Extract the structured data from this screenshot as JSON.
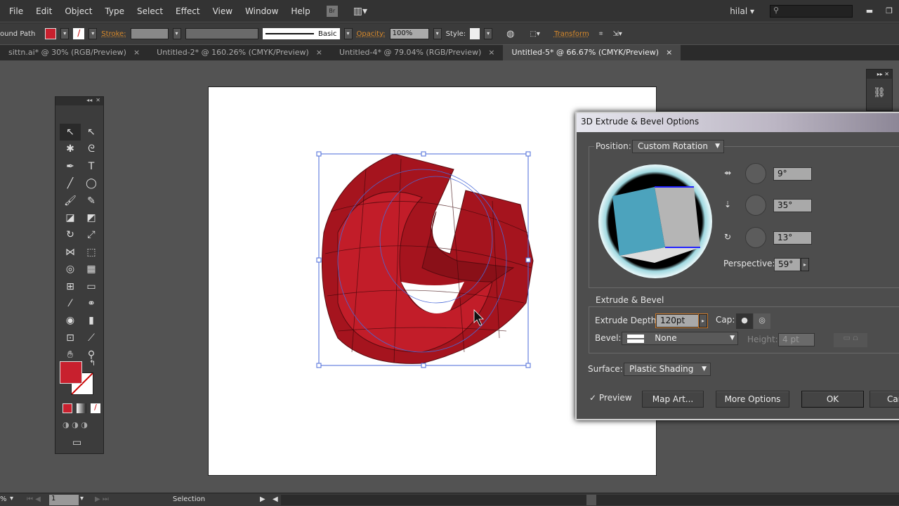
{
  "menu": [
    "File",
    "Edit",
    "Object",
    "Type",
    "Select",
    "Effect",
    "View",
    "Window",
    "Help"
  ],
  "menu_icons": [
    "bridge-icon",
    "arrange-documents-icon"
  ],
  "user": "hilal",
  "control": {
    "selection_type": "ound Path",
    "stroke_label": "Stroke:",
    "stroke_profile": "Basic",
    "opacity_label": "Opacity:",
    "opacity": "100%",
    "style_label": "Style:",
    "transform_label": "Transform",
    "fill_color": "#c8202e"
  },
  "tabs": [
    {
      "label": "sittn.ai* @ 30% (RGB/Preview)",
      "active": false
    },
    {
      "label": "Untitled-2* @ 160.26% (CMYK/Preview)",
      "active": false
    },
    {
      "label": "Untitled-4* @ 79.04% (RGB/Preview)",
      "active": false
    },
    {
      "label": "Untitled-5* @ 66.67% (CMYK/Preview)",
      "active": true
    }
  ],
  "tools": [
    "selection",
    "direct-selection",
    "magic-wand",
    "lasso",
    "pen",
    "type",
    "line",
    "ellipse",
    "paintbrush",
    "pencil",
    "blob-brush",
    "eraser",
    "rotate",
    "scale",
    "width",
    "free-transform",
    "shape-builder",
    "perspective-grid",
    "mesh",
    "gradient",
    "eyedropper",
    "blend",
    "symbol-sprayer",
    "column-graph",
    "artboard",
    "slice",
    "hand",
    "zoom"
  ],
  "dialog": {
    "title": "3D Extrude & Bevel Options",
    "position_label": "Position:",
    "position": "Custom Rotation",
    "rot_x": "9°",
    "rot_y": "35°",
    "rot_z": "13°",
    "perspective_label": "Perspective:",
    "perspective": "59°",
    "extrude_section": "Extrude & Bevel",
    "extrude_depth_label": "Extrude Depth:",
    "extrude_depth": "120pt",
    "cap_label": "Cap:",
    "bevel_label": "Bevel:",
    "bevel": "None",
    "height_label": "Height:",
    "height": "4 pt",
    "surface_label": "Surface:",
    "surface": "Plastic Shading",
    "preview_label": "Preview",
    "preview_checked": true,
    "map_art": "Map Art...",
    "more_options": "More Options",
    "ok": "OK",
    "cancel": "Car"
  },
  "status": {
    "zoom": "%",
    "page": "1",
    "tool": "Selection"
  }
}
